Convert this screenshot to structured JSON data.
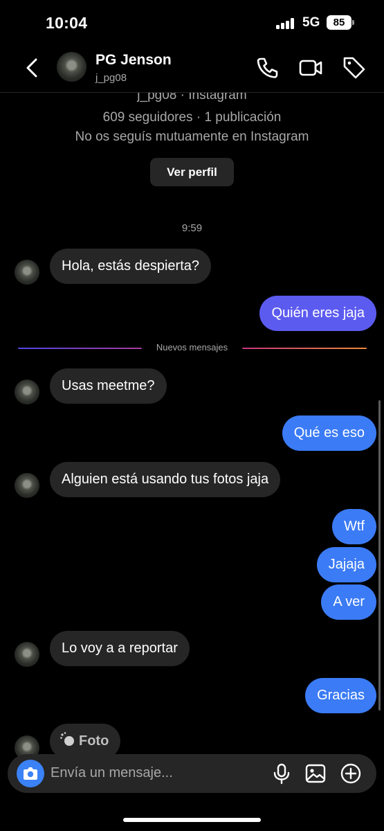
{
  "status_bar": {
    "time": "10:04",
    "network": "5G",
    "battery": "85"
  },
  "header": {
    "name": "PG Jenson",
    "username": "j_pg08"
  },
  "profile_info": {
    "line1": "j_pg08 · Instagram",
    "line2": "609 seguidores · 1 publicación",
    "line3": "No os seguís mutuamente en Instagram",
    "button": "Ver perfil"
  },
  "timestamp": "9:59",
  "new_messages_label": "Nuevos mensajes",
  "messages": [
    {
      "text": "Hola, estás despierta?",
      "from": "them"
    },
    {
      "text": "Quién eres jaja",
      "from": "me"
    },
    {
      "text": "Usas meetme?",
      "from": "them"
    },
    {
      "text": "Qué es eso",
      "from": "me"
    },
    {
      "text": "Alguien está usando tus fotos jaja",
      "from": "them"
    },
    {
      "text": "Wtf",
      "from": "me"
    },
    {
      "text": "Jajaja",
      "from": "me"
    },
    {
      "text": "A ver",
      "from": "me"
    },
    {
      "text": "Lo voy a a reportar",
      "from": "them"
    },
    {
      "text": "Gracias",
      "from": "me"
    },
    {
      "text": "Foto",
      "from": "them"
    }
  ],
  "composer": {
    "placeholder": "Envía un mensaje..."
  },
  "colors": {
    "incoming": "#262626",
    "outgoing": "#3b7bf5",
    "outgoing_first": "#5c5bf0",
    "camera": "#3b82f6"
  }
}
